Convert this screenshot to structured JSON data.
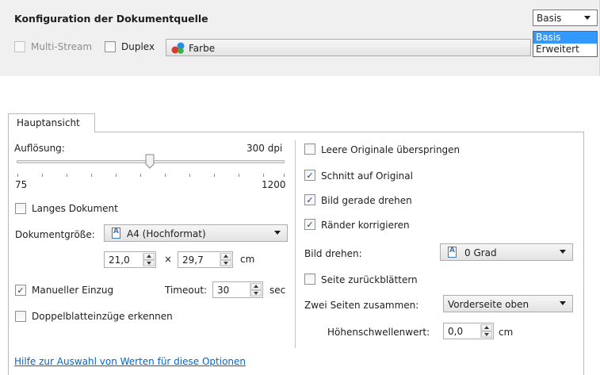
{
  "source_config": {
    "title": "Konfiguration der Dokumentquelle",
    "multistream_label": "Multi-Stream",
    "multistream_checked": false,
    "duplex_label": "Duplex",
    "duplex_checked": false,
    "color_mode": "Farbe",
    "color_icon": "color-sphere-icon",
    "profile_selected": "Basis",
    "profile_options": [
      "Basis",
      "Erweitert"
    ]
  },
  "tabs": {
    "main_label": "Hauptansicht"
  },
  "left": {
    "resolution_label": "Auflösung:",
    "resolution_value": "300 dpi",
    "resolution_min": "75",
    "resolution_max": "1200",
    "long_document_label": "Langes Dokument",
    "long_document_checked": false,
    "document_size_label": "Dokumentgröße:",
    "document_size_value": "A4 (Hochformat)",
    "width_value": "21,0",
    "times_sign": "×",
    "height_value": "29,7",
    "unit_cm": "cm",
    "manual_feed_label": "Manueller Einzug",
    "manual_feed_checked": true,
    "timeout_label": "Timeout:",
    "timeout_value": "30",
    "timeout_unit": "sec",
    "double_feed_label": "Doppelblatteinzüge erkennen",
    "double_feed_checked": false
  },
  "right": {
    "skip_blank_label": "Leere Originale überspringen",
    "skip_blank_checked": false,
    "crop_label": "Schnitt auf Original",
    "crop_checked": true,
    "straighten_label": "Bild gerade drehen",
    "straighten_checked": true,
    "edges_label": "Ränder korrigieren",
    "edges_checked": true,
    "rotate_label": "Bild drehen:",
    "rotate_value": "0 Grad",
    "flip_page_label": "Seite zurückblättern",
    "flip_page_checked": false,
    "merge_label": "Zwei Seiten zusammen:",
    "merge_value": "Vorderseite oben",
    "height_threshold_label": "Höhenschwellenwert:",
    "height_threshold_value": "0,0",
    "height_threshold_unit": "cm"
  },
  "help_link": "Hilfe zur Auswahl von Werten für diese Optionen",
  "check_mark": "✓"
}
